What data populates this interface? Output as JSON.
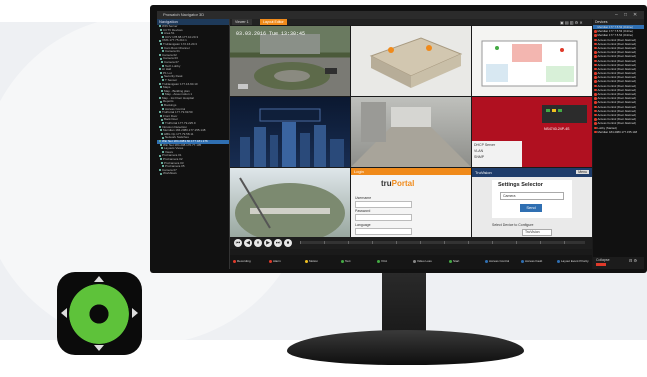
{
  "app": {
    "title": "Prowatch Navigator 3D",
    "window_controls": [
      "–",
      "□",
      "✕"
    ]
  },
  "nav_panel": {
    "header": "Navigation",
    "items": [
      {
        "label": "WIN Server"
      },
      {
        "label": "CCTV Devices"
      },
      {
        "label": "Area 51"
      },
      {
        "label": "CCV 178.68.177.10.20.3"
      },
      {
        "label": "VMS 177.75.210.1"
      },
      {
        "label": "TruNavigator 172.16.20.3"
      },
      {
        "label": "Cam Root Channel"
      },
      {
        "label": "Camera 01"
      },
      {
        "label": "Camera 02"
      },
      {
        "label": "Camera 03"
      },
      {
        "label": "Camera 07"
      },
      {
        "label": "Tech Lobby"
      },
      {
        "label": "Ar Hall"
      },
      {
        "label": "P1 Lot"
      },
      {
        "label": "Security Desk"
      },
      {
        "label": "T Sensor"
      },
      {
        "label": "TruNavigator 177.16.60.10"
      },
      {
        "label": "Maps"
      },
      {
        "label": "Map - Building plan"
      },
      {
        "label": "Map - Area motion 1"
      },
      {
        "label": "Map - 1st Floor Hospital"
      },
      {
        "label": "Reports"
      },
      {
        "label": "Bookings"
      },
      {
        "label": "Access Control"
      },
      {
        "label": "TruPortal 177.79.69.50"
      },
      {
        "label": "Front Door"
      },
      {
        "label": "Back Door"
      },
      {
        "label": "TruPortal 177.79.225.9"
      },
      {
        "label": "Intrusion Detection"
      },
      {
        "label": "Meridian 184.2080.177.155.148"
      },
      {
        "label": "HBG Op 177.79.58.11"
      },
      {
        "label": "Network Switches"
      },
      {
        "label": "Win Net 184.2083.60.177.181.176"
      },
      {
        "label": "Win Net 184.208.170.77.105"
      },
      {
        "label": "Layouts Views"
      },
      {
        "label": "Views"
      },
      {
        "label": "ProCamera 01"
      },
      {
        "label": "ProCamera 02"
      },
      {
        "label": "ProCamera 03"
      },
      {
        "label": "ProCamera 05"
      },
      {
        "label": "Camera 07"
      },
      {
        "label": "Workflows"
      }
    ],
    "selected_index": 32
  },
  "tabs": [
    {
      "label": "Viewer 1"
    },
    {
      "label": "Layout Editor"
    }
  ],
  "cells": {
    "cam1": {
      "timestamp": "03.03.2016  Tue 13:30:45"
    },
    "truportal": {
      "header": "Login",
      "logo_prefix": "tru",
      "logo_suffix": "Portal",
      "username_label": "Username",
      "password_label": "Password",
      "language_label": "Language"
    },
    "settings": {
      "header": "TruVision",
      "menu_label": "Menu",
      "title": "Settings Selector",
      "select_value": "Camera",
      "send_label": "Send",
      "footer_label": "Select Device to Configure",
      "footer_value": "TruVision"
    },
    "switch": {
      "model": "NS4740-24P-4S",
      "table": [
        "DHCP Server",
        "VLAN",
        "SNMP"
      ]
    }
  },
  "devices": {
    "header": "Devices",
    "items": [
      {
        "label": "Meridian 177.7.5.52 (Online)",
        "color": "#2f6fb2"
      },
      {
        "label": "Meridian 177.7.5.53 (Online)",
        "color": "#e03a2a"
      },
      {
        "label": "Meridian 177.7.5.54 (Online)",
        "color": "#e03a2a"
      },
      {
        "label": "Access Control (Door Alarmed)",
        "color": "#e03a2a"
      },
      {
        "label": "Access Control (Door Alarmed)",
        "color": "#e03a2a"
      },
      {
        "label": "Access Control (Door Alarmed)",
        "color": "#e03a2a"
      },
      {
        "label": "Access Control (Door Alarmed)",
        "color": "#e03a2a"
      },
      {
        "label": "Access Control (Door Alarmed)",
        "color": "#e03a2a"
      },
      {
        "label": "Access Control (Door Alarmed)",
        "color": "#e03a2a"
      },
      {
        "label": "Access Control (Door Alarmed)",
        "color": "#e03a2a"
      },
      {
        "label": "Access Control (Door Alarmed)",
        "color": "#e03a2a"
      },
      {
        "label": "Access Control (Door Alarmed)",
        "color": "#e03a2a"
      },
      {
        "label": "Access Control (Door Alarmed)",
        "color": "#e03a2a"
      },
      {
        "label": "Access Control (Door Alarmed)",
        "color": "#e03a2a"
      },
      {
        "label": "Access Control (Door Alarmed)",
        "color": "#e03a2a"
      },
      {
        "label": "Access Control (Door Alarmed)",
        "color": "#e03a2a"
      },
      {
        "label": "Access Control (Door Alarmed)",
        "color": "#e03a2a"
      },
      {
        "label": "Access Control (Door Alarmed)",
        "color": "#e03a2a"
      },
      {
        "label": "Access Control (Door Alarmed)",
        "color": "#e03a2a"
      },
      {
        "label": "Access Control (Door Alarmed)",
        "color": "#e03a2a"
      },
      {
        "label": "Access Control (Door Alarmed)",
        "color": "#e03a2a"
      },
      {
        "label": "Access Control (Door Alarmed)",
        "color": "#e03a2a"
      },
      {
        "label": "Access Control (Door Alarmed)",
        "color": "#e03a2a"
      },
      {
        "label": "Access Control (Door Alarmed)",
        "color": "#e03a2a"
      },
      {
        "label": "Lobby (Started)",
        "color": "#e03a2a"
      },
      {
        "label": "Meridian 184.2080.177.155.148",
        "color": "#e03a2a"
      }
    ],
    "selected_index": 0,
    "collapse_label": "Collapse"
  },
  "playback": {
    "buttons": [
      "⏮",
      "◀",
      "⏸",
      "▶",
      "⏭",
      "⏹"
    ]
  },
  "status_legend": [
    {
      "label": "Recording",
      "color": "#e03a2a"
    },
    {
      "label": "Alarm",
      "color": "#e03a2a"
    },
    {
      "label": "Motion",
      "color": "#f0c020"
    },
    {
      "label": "Text",
      "color": "#44aa44"
    },
    {
      "label": "VCA",
      "color": "#44aa44"
    },
    {
      "label": "Video Loss",
      "color": "#888888"
    },
    {
      "label": "Start",
      "color": "#44aa44"
    },
    {
      "label": "Access Control",
      "color": "#2f6fb2"
    },
    {
      "label": "Access Fault",
      "color": "#2f6fb2"
    },
    {
      "label": "Layout Event Priority",
      "color": "#2f6fb2"
    }
  ]
}
